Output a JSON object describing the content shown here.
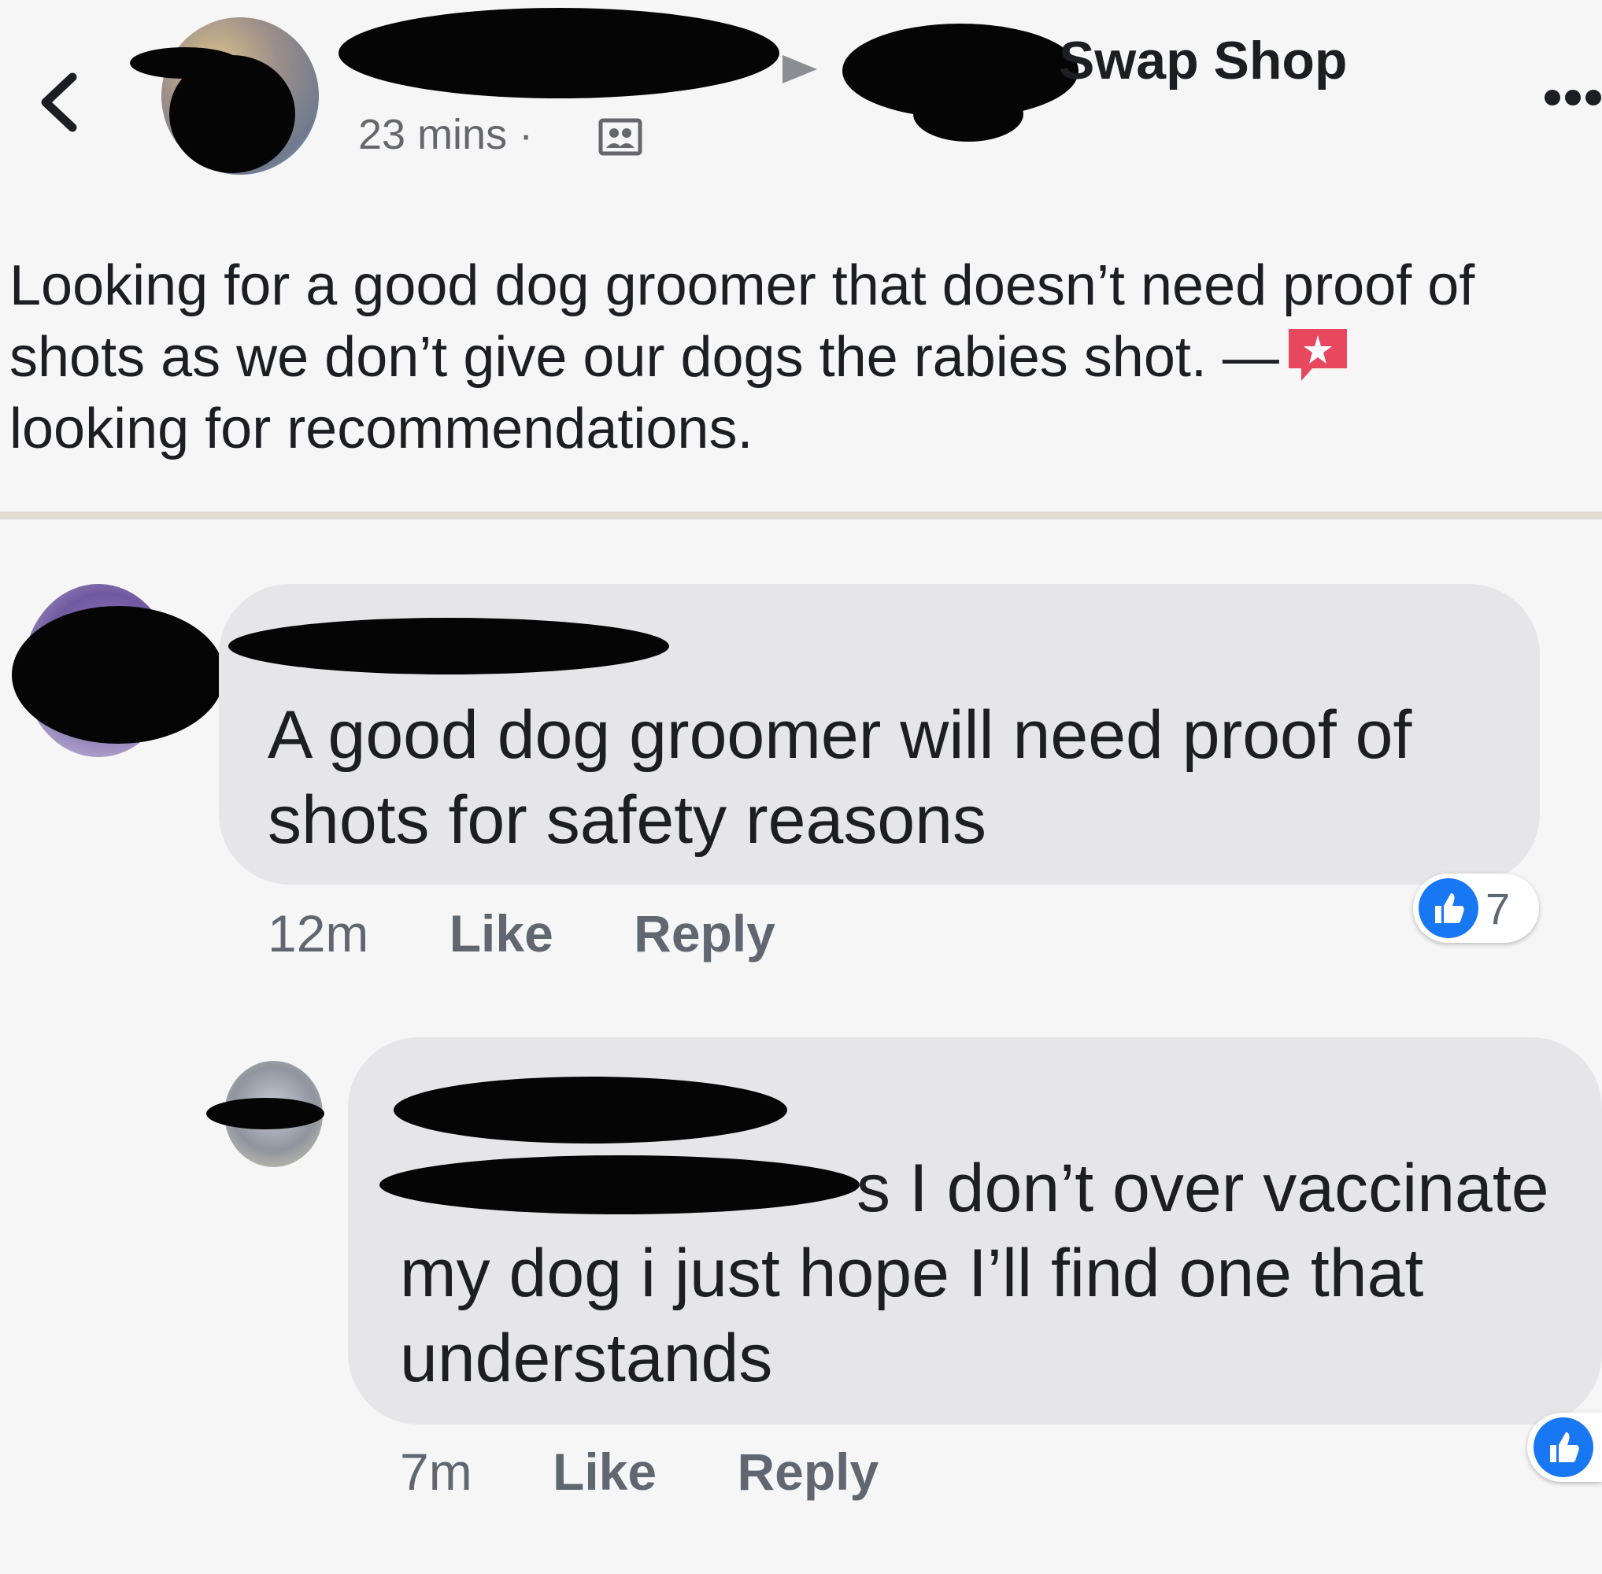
{
  "post": {
    "group_name": "Swap Shop",
    "time": "23 mins ·",
    "text_line1": "Looking for a good dog groomer that doesn’t need proof of",
    "text_line2": "shots as we don’t give our dogs the rabies shot. —",
    "text_line3": "looking for recommendations.",
    "icons": [
      "back-chevron-icon",
      "audience-group-icon",
      "arrow-right-icon",
      "more-options-icon",
      "recommendation-star-icon"
    ]
  },
  "comments": [
    {
      "text_line1": "A good dog groomer will need proof of",
      "text_line2": "shots for safety reasons",
      "time": "12m",
      "like_label": "Like",
      "reply_label": "Reply",
      "reaction_count": "7"
    },
    {
      "text_line1": "s I don’t over vaccinate",
      "text_line2": "my dog i just hope I’ll find one that",
      "text_line3": "understands",
      "time": "7m",
      "like_label": "Like",
      "reply_label": "Reply"
    }
  ],
  "colors": {
    "background": "#f6f6f7",
    "bubble": "#e6e6e8",
    "meta_text": "#606770",
    "like_blue": "#1877f2",
    "badge_red": "#e8485f"
  }
}
